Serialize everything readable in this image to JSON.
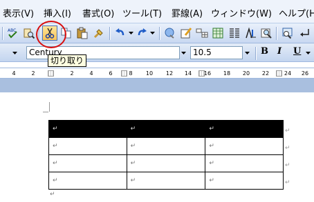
{
  "menu": [
    "表示(V)",
    "挿入(I)",
    "書式(O)",
    "ツール(T)",
    "罫線(A)",
    "ウィンドウ(W)",
    "ヘルプ(H)"
  ],
  "toolbar": {
    "font_name": "Century",
    "font_size": "10.5",
    "bold": "B",
    "italic": "I",
    "underline": "U"
  },
  "tooltip": "切り取り",
  "ruler": {
    "numbers": [
      "4",
      "2",
      "2",
      "4",
      "6",
      "8",
      "10",
      "12",
      "14",
      "16",
      "18",
      "20",
      "22",
      "24",
      "26"
    ]
  },
  "table": {
    "rows": [
      [
        "↵",
        "↵",
        "↵"
      ],
      [
        "↵",
        "↵",
        "↵"
      ],
      [
        "↵",
        "↵",
        "↵"
      ],
      [
        "↵",
        "↵",
        "↵"
      ]
    ],
    "end_marks": [
      "↵",
      "↵",
      "↵",
      "↵"
    ]
  },
  "paragraph_mark": "↵",
  "colors": {
    "highlight": "#d90f0f",
    "tooltip_bg": "#ffffe1",
    "selection": "#000000"
  }
}
